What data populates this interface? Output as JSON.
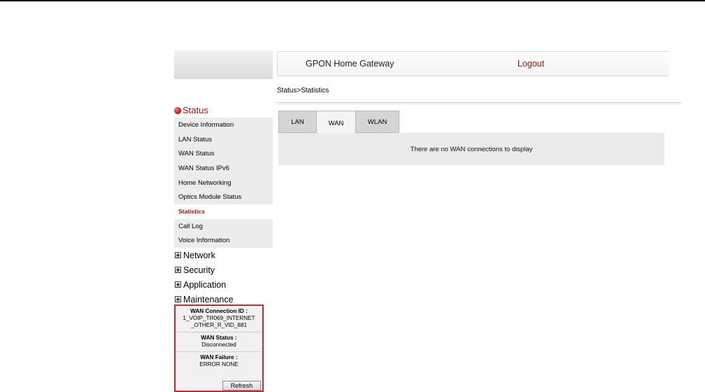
{
  "header": {
    "title": "GPON Home Gateway",
    "logout": "Logout"
  },
  "breadcrumb": "Status>Statistics",
  "sidebar": {
    "active_section": "Status",
    "status_items": [
      "Device Information",
      "LAN Status",
      "WAN Status",
      "WAN Status IPv6",
      "Home Networking",
      "Optics Module Status",
      "Statistics",
      "Call Log",
      "Voice Information"
    ],
    "active_item": "Statistics",
    "collapsed_sections": [
      "Network",
      "Security",
      "Application",
      "Maintenance"
    ]
  },
  "info_box": {
    "conn_id_label": "WAN Connection ID :",
    "conn_id_value_line1": "1_VOIP_TR069_INTERNET",
    "conn_id_value_line2": "_OTHER_R_VID_881",
    "status_label": "WAN Status :",
    "status_value": "Disconnected",
    "failure_label": "WAN Failure :",
    "failure_value": "ERROR NONE",
    "refresh_label": "Refresh"
  },
  "tabs": [
    "LAN",
    "WAN",
    "WLAN"
  ],
  "active_tab": "WAN",
  "panel_message": "There are no WAN connections to display",
  "colors": {
    "accent": "#9b0f0f",
    "infobox_border": "#d4242b"
  }
}
